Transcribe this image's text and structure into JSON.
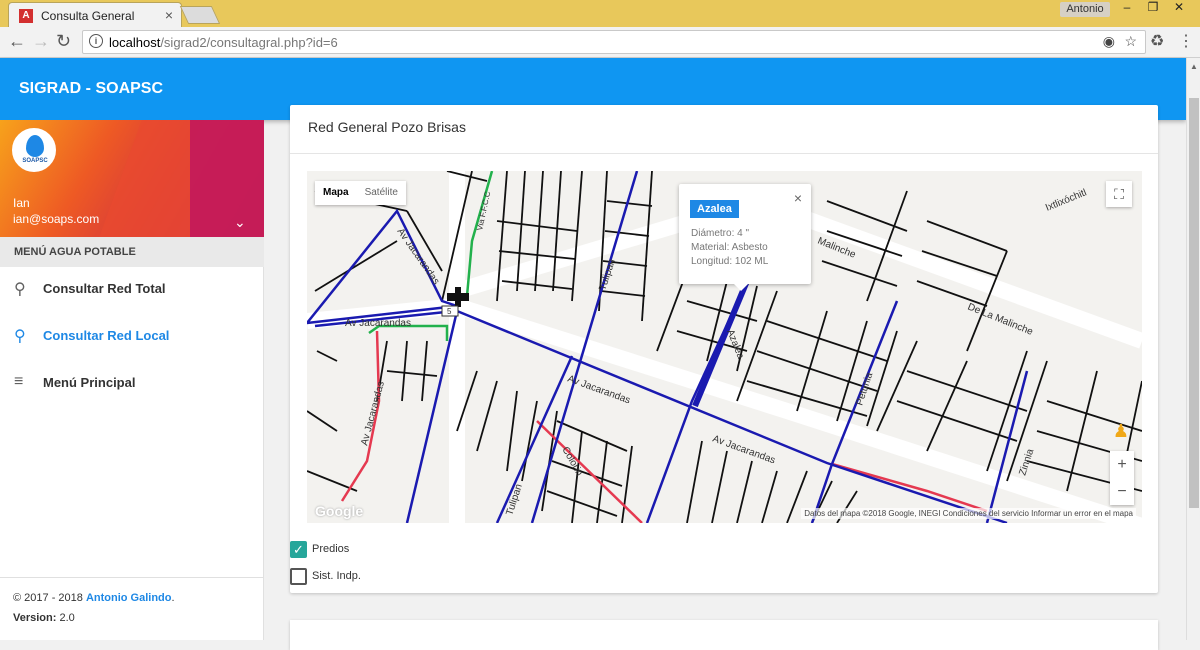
{
  "browser": {
    "tab_title": "Consulta General",
    "tab_favicon": "A",
    "user_badge": "Antonio",
    "url_host": "localhost",
    "url_path": "/sigrad2/consultagral.php?id=6"
  },
  "appbar": {
    "title": "SIGRAD - SOAPSC"
  },
  "profile": {
    "logo_text": "SOAPSC",
    "name": "Ian",
    "email": "ian@soaps.com"
  },
  "menu": {
    "section": "MENÚ AGUA POTABLE",
    "items": [
      {
        "label": "Consultar Red Total",
        "icon": "search-icon",
        "active": false
      },
      {
        "label": "Consultar Red Local",
        "icon": "search-icon",
        "active": true
      },
      {
        "label": "Menú Principal",
        "icon": "menu-lines-icon",
        "active": false
      }
    ]
  },
  "footer": {
    "copyright": "© 2017 - 2018",
    "author": "Antonio Galindo",
    "version_label": "Version:",
    "version": "2.0"
  },
  "card": {
    "title": "Red General Pozo Brisas"
  },
  "map": {
    "map_type_map": "Mapa",
    "map_type_sat": "Satélite",
    "google": "Google",
    "attribution": "Datos del mapa ©2018 Google, INEGI   Condiciones del servicio   Informar un error en el mapa",
    "street_labels": [
      "Av Jacarandas",
      "Av Jacarandas",
      "Av Jacarandas",
      "Av Jacarandas",
      "Av Jacarandas",
      "Tulipan",
      "Tulipan",
      "Azalea",
      "Colorin",
      "Petunia",
      "Zinnia",
      "Malinche",
      "De La Malinche",
      "Ixtlixóchitl",
      "Via F.F.C.C",
      "5"
    ],
    "popup": {
      "title": "Azalea",
      "diametro": "Diámetro: 4 \"",
      "material": "Material: Asbesto",
      "longitud": "Longitud: 102 ML"
    }
  },
  "layers": [
    {
      "label": "Predios",
      "checked": true
    },
    {
      "label": "Sist. Indp.",
      "checked": false
    }
  ],
  "colors": {
    "appbar": "#0f96f2",
    "accent": "#1e88e5",
    "pipe_blue": "#1a1ab0",
    "pipe_red": "#e53950",
    "pipe_green": "#22b14c"
  }
}
